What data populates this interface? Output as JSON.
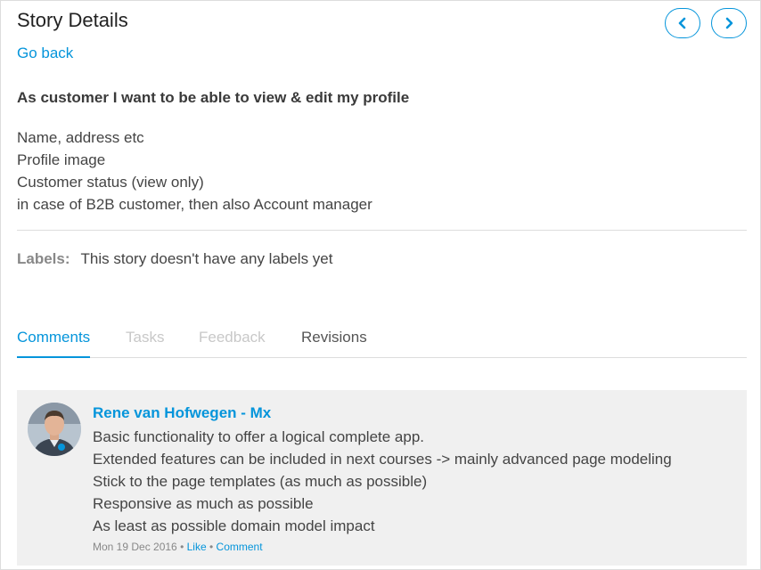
{
  "header": {
    "title": "Story Details",
    "go_back": "Go back",
    "prev_icon": "chevron-left-icon",
    "next_icon": "chevron-right-icon"
  },
  "story": {
    "title": "As customer I want to be able to view & edit my profile",
    "description_lines": [
      "Name, address etc",
      "Profile image",
      "Customer status (view only)",
      "in case of B2B customer, then also Account manager"
    ]
  },
  "labels": {
    "key": "Labels:",
    "value": "This story doesn't have any labels yet"
  },
  "tabs": [
    {
      "label": "Comments",
      "state": "active"
    },
    {
      "label": "Tasks",
      "state": "disabled"
    },
    {
      "label": "Feedback",
      "state": "disabled"
    },
    {
      "label": "Revisions",
      "state": "normal"
    }
  ],
  "comment": {
    "author": "Rene van Hofwegen - Mx",
    "lines": [
      "Basic functionality to offer a logical complete app.",
      "Extended features can be included in next courses -> mainly advanced page modeling",
      "Stick to the page templates (as much as possible)",
      "Responsive as much as possible",
      "As least as possible domain model impact"
    ],
    "date": "Mon 19 Dec 2016",
    "separator": "•",
    "like": "Like",
    "comment_link": "Comment"
  },
  "colors": {
    "accent": "#0595db",
    "comment_bg": "#f0f0f0",
    "disabled_tab": "#c8c8c8"
  }
}
